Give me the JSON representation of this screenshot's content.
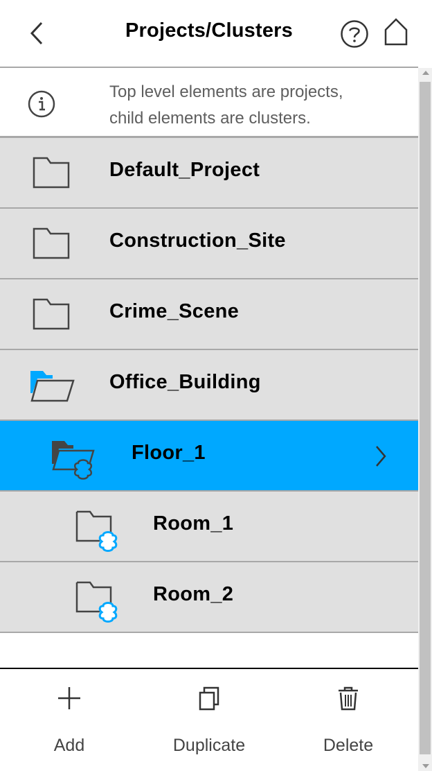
{
  "header": {
    "title": "Projects/Clusters",
    "back_icon": "chevron-left-icon",
    "help_icon": "help-circle-icon",
    "home_icon": "home-icon"
  },
  "info": {
    "icon": "info-icon",
    "text_line1": "Top level elements are projects,",
    "text_line2": "child elements are clusters."
  },
  "items": [
    {
      "label": "Default_Project",
      "icon": "folder-icon",
      "level": 0,
      "selected": false
    },
    {
      "label": "Construction_Site",
      "icon": "folder-icon",
      "level": 0,
      "selected": false
    },
    {
      "label": "Crime_Scene",
      "icon": "folder-icon",
      "level": 0,
      "selected": false
    },
    {
      "label": "Office_Building",
      "icon": "folder-open-icon",
      "level": 0,
      "selected": false
    },
    {
      "label": "Floor_1",
      "icon": "cluster-folder-open-icon",
      "level": 1,
      "selected": true
    },
    {
      "label": "Room_1",
      "icon": "cluster-folder-icon",
      "level": 2,
      "selected": false
    },
    {
      "label": "Room_2",
      "icon": "cluster-folder-icon",
      "level": 2,
      "selected": false
    }
  ],
  "footer": {
    "add_label": "Add",
    "duplicate_label": "Duplicate",
    "delete_label": "Delete"
  },
  "colors": {
    "accent": "#00a8ff",
    "row_bg": "#e0e0e0",
    "divider": "#a8a8a8"
  }
}
